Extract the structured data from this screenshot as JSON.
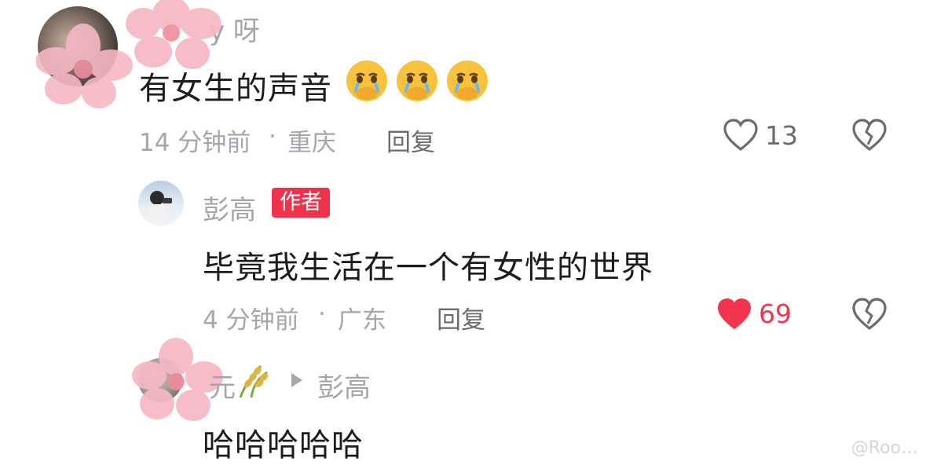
{
  "comments": [
    {
      "author": "y 呀",
      "text": "有女生的声音",
      "emoji_icon": "crying-face-covering-mouth-icon",
      "time": "14 分钟前",
      "location": "重庆",
      "reply_label": "回复",
      "likes": "13",
      "liked": false
    },
    {
      "author": "彭高",
      "badge": "作者",
      "text": "毕竟我生活在一个有女性的世界",
      "time": "4 分钟前",
      "location": "广东",
      "reply_label": "回复",
      "likes": "69",
      "liked": true,
      "like_color": "#f2344d"
    },
    {
      "author": "元",
      "author_icon": "rice-ear-icon",
      "reply_to": "彭高",
      "text": "哈哈哈哈哈"
    }
  ],
  "separator": "·",
  "watermark_text": "@Roo…"
}
